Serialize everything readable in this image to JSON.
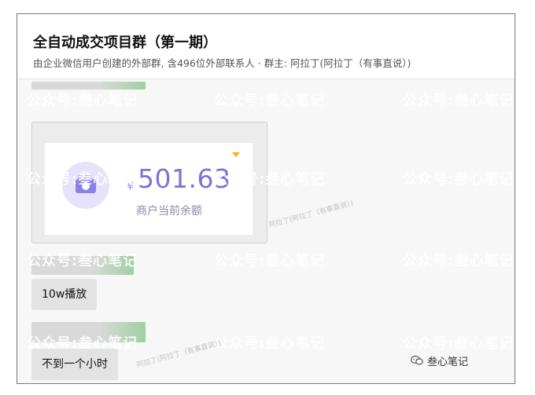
{
  "header": {
    "title": "全自动成交项目群（第一期）",
    "subtitle": "由企业微信用户创建的外部群, 含496位外部联系人 · 群主: 阿拉丁(阿拉丁（有事直说）)"
  },
  "card": {
    "currency_symbol": "¥",
    "amount": "501.63",
    "label": "商户当前余额"
  },
  "buttons": {
    "plays": "10w播放",
    "time": "不到一个小时"
  },
  "watermark": {
    "text": "公众号:叁心笔记",
    "diagonal_text": "阿拉丁(阿拉丁（有事直说）)"
  },
  "brand": {
    "text": "叁心笔记",
    "icon": "wechat-official-account-icon"
  },
  "colors": {
    "accent": "#7b74d6",
    "wallet_bg": "#e5e3f9",
    "arrow": "#f5b400"
  }
}
